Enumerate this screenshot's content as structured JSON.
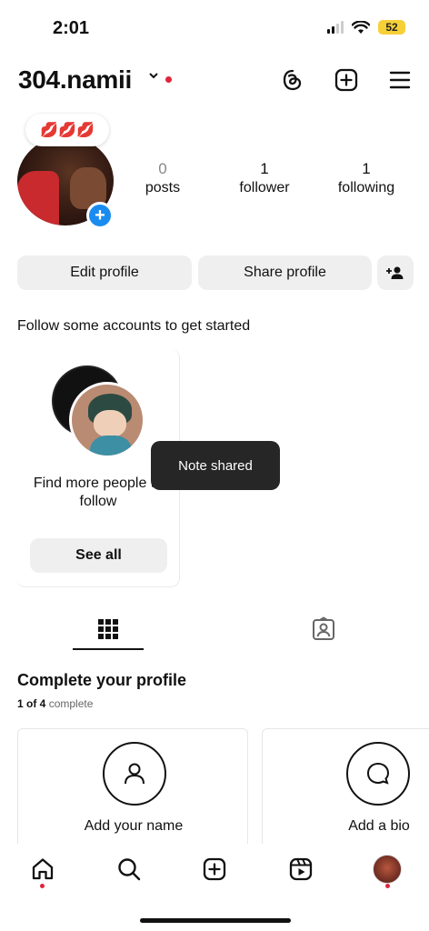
{
  "status_bar": {
    "time": "2:01",
    "battery": "52"
  },
  "header": {
    "username": "304.namii",
    "chevron": "⌄",
    "icons": [
      "threads-icon",
      "create-icon",
      "menu-icon"
    ]
  },
  "profile": {
    "note_emojis": "💋💋💋",
    "add_story": "+",
    "stats": [
      {
        "value": "0",
        "label": "posts"
      },
      {
        "value": "1",
        "label": "follower"
      },
      {
        "value": "1",
        "label": "following"
      }
    ]
  },
  "actions": {
    "edit": "Edit profile",
    "share": "Share profile"
  },
  "suggestions": {
    "heading": "Follow some accounts to get started",
    "card_text": "Find more people to follow",
    "see_all": "See all"
  },
  "toast": "Note shared",
  "completion": {
    "title": "Complete your profile",
    "progress_count": "1 of 4",
    "progress_word": "complete",
    "tasks": [
      {
        "label": "Add your name",
        "icon": "person-icon"
      },
      {
        "label": "Add a bio",
        "icon": "speech-bubble-icon"
      }
    ]
  },
  "nav": [
    "home-icon",
    "search-icon",
    "create-icon",
    "reels-icon",
    "profile-avatar"
  ],
  "colors": {
    "accent_blue": "#1a8cf0",
    "notification_red": "#e0243c",
    "button_gray": "#efefef",
    "toast_bg": "#262626"
  }
}
